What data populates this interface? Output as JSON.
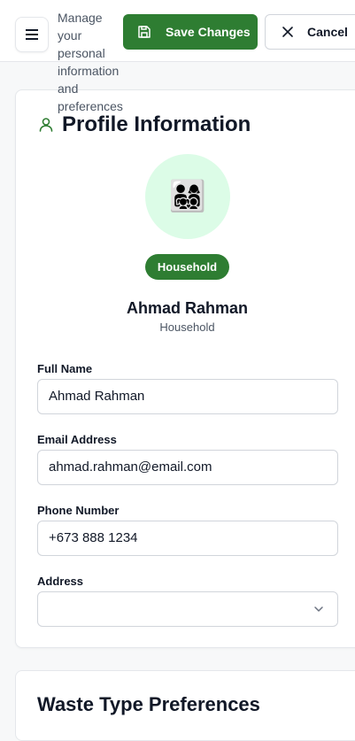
{
  "header": {
    "subtitle": "Manage your personal information and preferences",
    "save_label": "Save Changes",
    "cancel_label": "Cancel"
  },
  "profile": {
    "card_title": "Profile Information",
    "avatar_emoji": "👨‍👩‍👧‍👦",
    "badge": "Household",
    "name": "Ahmad Rahman",
    "role": "Household"
  },
  "form": {
    "full_name_label": "Full Name",
    "full_name_value": "Ahmad Rahman",
    "email_label": "Email Address",
    "email_value": "ahmad.rahman@email.com",
    "phone_label": "Phone Number",
    "phone_value": "+673 888 1234",
    "address_label": "Address",
    "address_value": ""
  },
  "waste": {
    "title": "Waste Type Preferences"
  },
  "colors": {
    "primary": "#2e7d32",
    "avatar_bg": "#dcfce7"
  }
}
